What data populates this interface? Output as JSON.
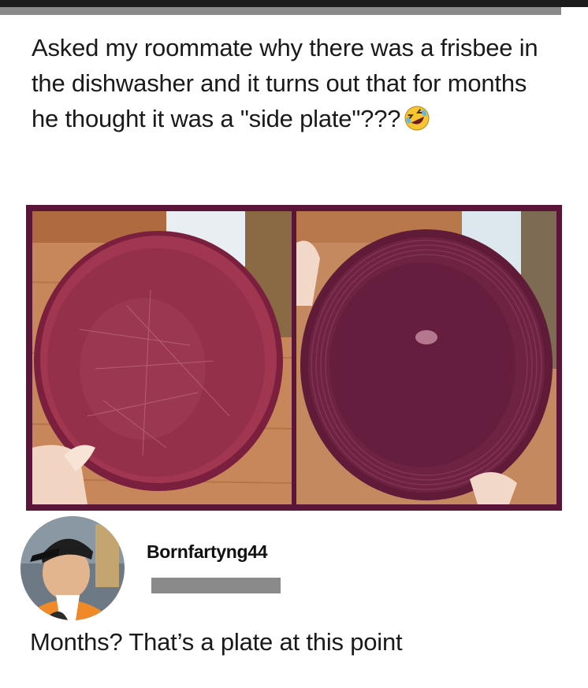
{
  "post": {
    "text": "Asked my roommate why there was a frisbee in the dishwasher and it turns out that for months he thought it was a \"side plate\"???",
    "emoji": "rolling-on-the-floor-laughing-icon"
  },
  "photos": {
    "left": "frisbee-top-view-icon",
    "right": "frisbee-underside-icon",
    "frame_color": "#5a1538",
    "frisbee_color": "#8e2a4a"
  },
  "comment": {
    "username": "Bornfartyng44",
    "text": "Months? That’s a plate at this point"
  }
}
